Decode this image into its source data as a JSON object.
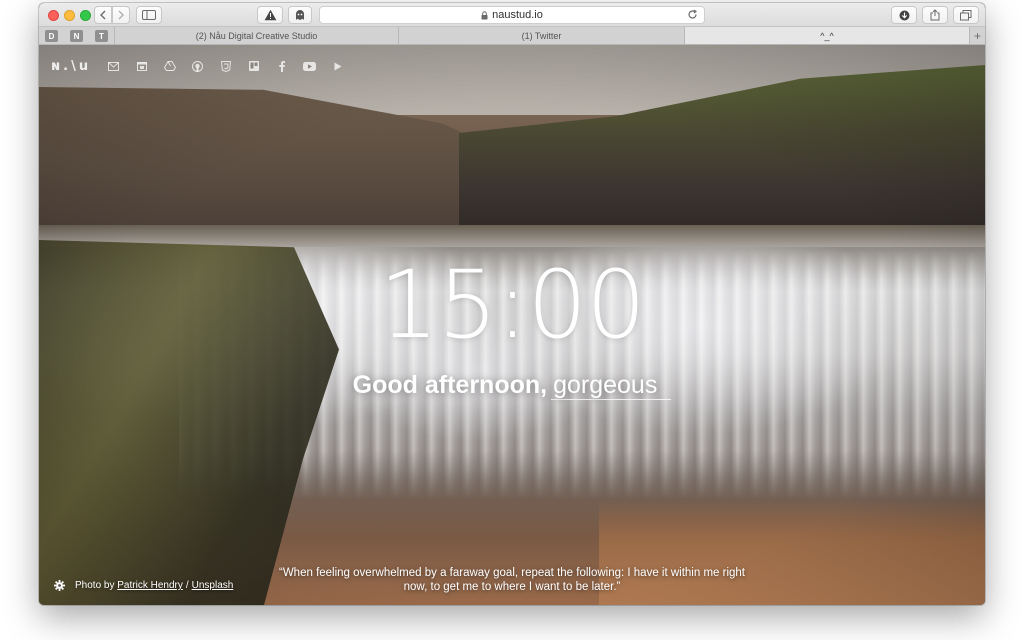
{
  "browser": {
    "url": "naustud.io",
    "pinned_tabs": [
      "D",
      "N",
      "T"
    ],
    "tabs": [
      {
        "label": "(2) Nåu Digital Creative Studio"
      },
      {
        "label": "(1) Twitter"
      },
      {
        "label": "^_^"
      }
    ],
    "new_tab_label": "+"
  },
  "page": {
    "logo": "ɴ.\\u",
    "quick_links": [
      "gmail-icon",
      "calendar-icon",
      "drive-icon",
      "github-icon",
      "html5-icon",
      "trello-icon",
      "facebook-icon",
      "youtube-icon",
      "play-icon"
    ],
    "clock": "15:00",
    "greeting_prefix": "Good afternoon,",
    "greeting_name": "gorgeous",
    "photo_credit_prefix": "Photo by",
    "photo_author": "Patrick Hendry",
    "photo_sep": "/",
    "photo_source": "Unsplash",
    "quote": "“When feeling overwhelmed by a faraway goal, repeat the following: I have it within me right now, to get me to where I want to be later.”"
  }
}
